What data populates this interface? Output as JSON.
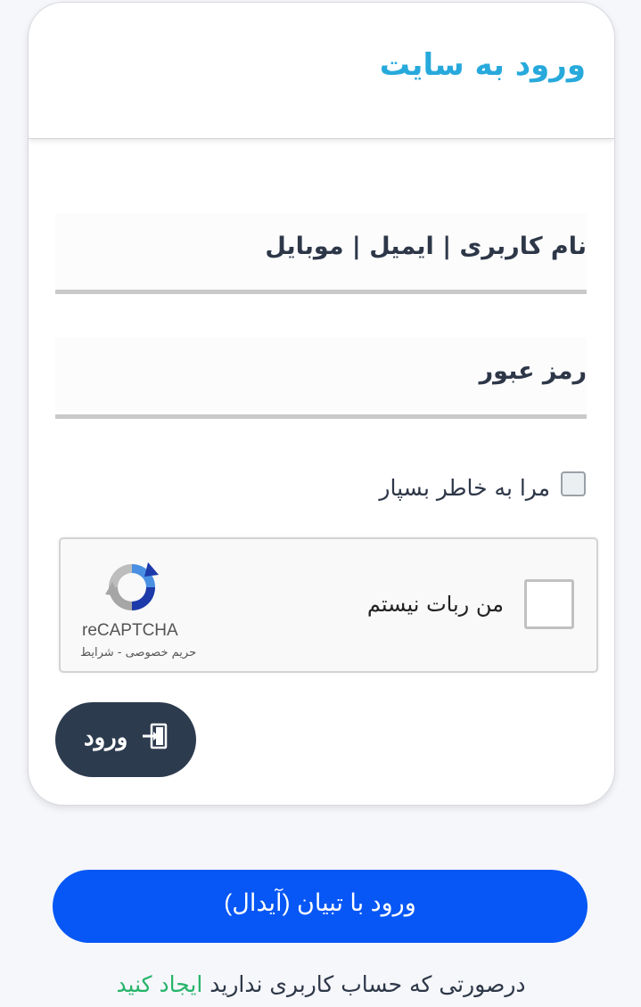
{
  "header": {
    "title": "ورود به سایت"
  },
  "form": {
    "username_label": "نام کاربری | ایمیل | موبایل",
    "password_label": "رمز عبور",
    "remember_label": "مرا به خاطر بسپار",
    "submit_label": "ورود"
  },
  "recaptcha": {
    "label": "من ربات نیستم",
    "brand": "reCAPTCHA",
    "terms": "حریم خصوصی - شرایط"
  },
  "tebyan": {
    "label": "ورود با تبیان (آیدال)"
  },
  "signup": {
    "text": "درصورتی که حساب کاربری ندارید ",
    "link": "ایجاد کنید"
  },
  "colors": {
    "title": "#27a9dc",
    "submit_button": "#2d3b4f",
    "tebyan_button": "#0657f5",
    "signup_link": "#25b46a"
  },
  "icons": {
    "submit": "login-door-icon",
    "recaptcha": "recaptcha-logo-icon"
  }
}
